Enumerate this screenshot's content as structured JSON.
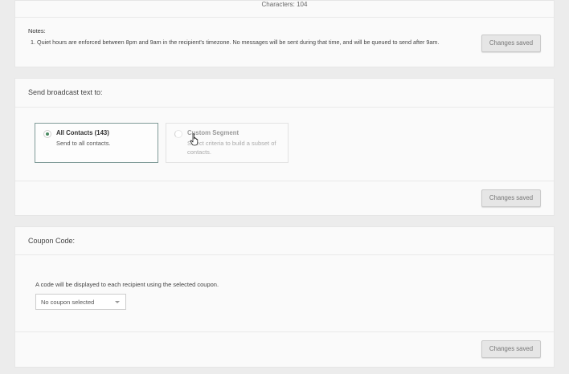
{
  "message": {
    "characters_label": "Characters: 104"
  },
  "notes": {
    "title": "Notes:",
    "line1_prefix": "1.",
    "line1": "Quiet hours are enforced between 8pm and 9am in the recipient's timezone. No messages will be sent during that time, and will be queued to send after 9am.",
    "save_label": "Changes saved"
  },
  "broadcast": {
    "title": "Send broadcast text to:",
    "options": [
      {
        "title": "All Contacts (143)",
        "description": "Send to all contacts.",
        "selected": true
      },
      {
        "title": "Custom Segment",
        "description": "Select criteria to build a subset of contacts.",
        "selected": false
      }
    ],
    "save_label": "Changes saved"
  },
  "coupon": {
    "title": "Coupon Code:",
    "help": "A code will be displayed to each recipient using the selected coupon.",
    "select_value": "No coupon selected",
    "save_label": "Changes saved"
  },
  "colors": {
    "background": "#ececec",
    "card": "#fafafa",
    "selected_border": "#7f9a97",
    "radio_accent": "#4a8a62",
    "button_bg": "#e6e6e6"
  },
  "icons": [
    "radio-selected-icon",
    "radio-unselected-icon",
    "hand-pointer-cursor-icon",
    "chevron-down-icon"
  ]
}
